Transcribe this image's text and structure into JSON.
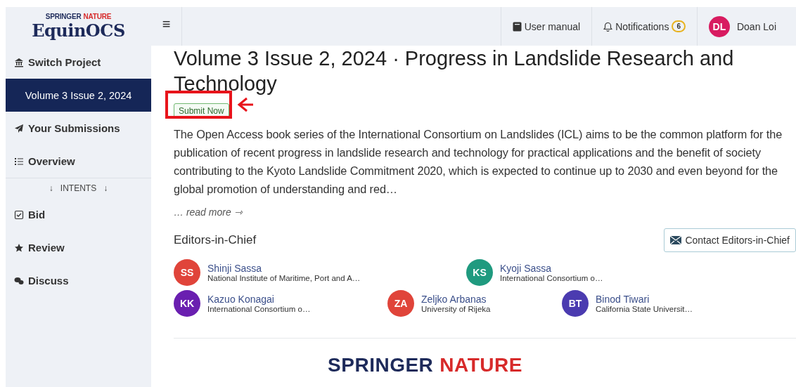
{
  "sidebar": {
    "brand": {
      "top_left": "SPRINGER",
      "top_right": "NATURE",
      "name": "EquinOCS"
    },
    "items": [
      {
        "kind": "link",
        "label": "Switch Project",
        "selected": false
      },
      {
        "kind": "link",
        "label": "Volume 3 Issue 2, 2024",
        "selected": true
      },
      {
        "kind": "link",
        "label": "Your Submissions",
        "selected": false
      },
      {
        "kind": "link",
        "label": "Overview",
        "selected": false
      },
      {
        "kind": "divider",
        "arrow": "↓",
        "label": "INTENTS"
      },
      {
        "kind": "link",
        "label": "Bid",
        "selected": false
      },
      {
        "kind": "link",
        "label": "Review",
        "selected": false
      },
      {
        "kind": "link",
        "label": "Discuss",
        "selected": false
      }
    ]
  },
  "topbar": {
    "menu": "≡",
    "manual": "User manual",
    "notifications": "Notifications",
    "notification_count": "6",
    "user_initials": "DL",
    "user_name": "Doan Loi"
  },
  "content": {
    "title": "Volume 3 Issue 2, 2024 · Progress in Landslide Research and Technology",
    "submit": "Submit Now",
    "description": "The Open Access book series of the International Consortium on Landslides (ICL) aims to be the common platform for the publication of recent progress in landslide research and technology for practical applications and the benefit of society contributing to the Kyoto Landslide Commitment 2020, which is expected to continue up to 2030 and even beyond for the global promotion of understanding and red…",
    "read_more": "… read more ⇾",
    "editors_heading": "Editors-in-Chief",
    "contact": "Contact Editors-in-Chief",
    "editors": [
      {
        "initials": "SS",
        "name": "Shinji Sassa",
        "affiliation": "National Institute of Maritime, Port and A…",
        "color": "#e0443a"
      },
      {
        "initials": "KS",
        "name": "Kyoji Sassa",
        "affiliation": "International Consortium o…",
        "color": "#1f9a7f"
      },
      {
        "initials": "KK",
        "name": "Kazuo Konagai",
        "affiliation": "International Consortium o…",
        "color": "#6a1fb0"
      },
      {
        "initials": "ZA",
        "name": "Zeljko Arbanas",
        "affiliation": "University of Rijeka",
        "color": "#e0443a"
      },
      {
        "initials": "BT",
        "name": "Binod Tiwari",
        "affiliation": "California State Universit…",
        "color": "#4b3bb0"
      }
    ],
    "footer": {
      "left": "SPRINGER",
      "right": "NATURE"
    }
  }
}
